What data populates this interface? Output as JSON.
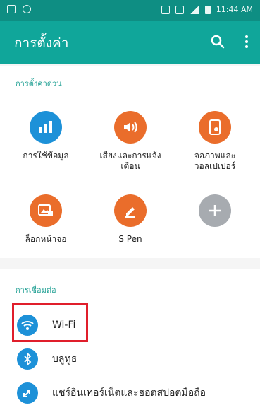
{
  "status_bar": {
    "time": "11:44 AM"
  },
  "app_bar": {
    "title": "การตั้งค่า",
    "icons": [
      "search-icon",
      "more-vert-icon"
    ]
  },
  "quick_settings": {
    "section_label": "การตั้งค่าด่วน",
    "items": [
      {
        "label": "การใช้ข้อมูล",
        "icon": "data-usage-icon",
        "color": "#1d91d8"
      },
      {
        "label": "เสียงและการแจ้งเตือน",
        "icon": "sound-icon",
        "color": "#ea6d2b"
      },
      {
        "label": "จอภาพและวอลเปเปอร์",
        "icon": "display-icon",
        "color": "#ea6d2b"
      },
      {
        "label": "ล็อกหน้าจอ",
        "icon": "lock-screen-icon",
        "color": "#ea6d2b"
      },
      {
        "label": "S Pen",
        "icon": "pen-icon",
        "color": "#ea6d2b"
      },
      {
        "label": "",
        "icon": "add-icon",
        "color": "#a7abb0"
      }
    ]
  },
  "connections": {
    "section_label": "การเชื่อมต่อ",
    "items": [
      {
        "label": "Wi-Fi",
        "icon": "wifi-icon"
      },
      {
        "label": "บลูทูธ",
        "icon": "bluetooth-icon"
      },
      {
        "label": "แชร์อินเทอร์เน็ตและฮอตสปอตมือถือ",
        "icon": "tethering-icon"
      }
    ]
  },
  "colors": {
    "app_bar": "#10a69a",
    "status_bar": "#0e8e83",
    "highlight": "#e01e2b"
  }
}
